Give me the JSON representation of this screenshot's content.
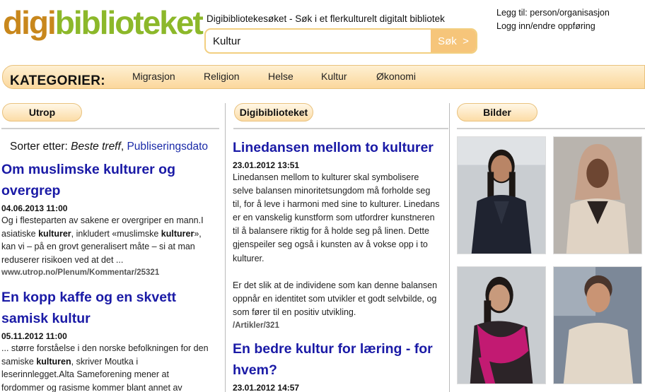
{
  "header": {
    "logo_part1": "digi",
    "logo_part2": "biblioteket",
    "tagline": "Digibibliotekesøket - Søk i et flerkulturelt digitalt bibliotek",
    "search": {
      "value": "Kultur",
      "button_label": "Søk",
      "button_arrow": ">"
    },
    "links": [
      "Legg til: person/organisasjon",
      "Logg inn/endre oppføring"
    ]
  },
  "categories": {
    "title": "KATEGORIER:",
    "items": [
      "Migrasjon",
      "Religion",
      "Helse",
      "Kultur",
      "Økonomi"
    ]
  },
  "columns": {
    "left": {
      "header": "Utrop",
      "sort_label": "Sorter etter:",
      "sort_best": "Beste treff",
      "sort_pub": "Publiseringsdato",
      "articles": [
        {
          "title_line1": "Om muslimske kulturer og",
          "title_line2": "overgrep",
          "date": "04.06.2013 11:00",
          "lines": [
            [
              "Og i flesteparten av sakene er overgriper en mann.I"
            ],
            [
              "asiatiske ",
              "kulturer",
              ", inkludert «muslimske ",
              "kulturer",
              "»,"
            ],
            [
              "kan vi – på en grovt generalisert måte – si at man"
            ],
            [
              "reduserer risikoen ved at det ..."
            ]
          ],
          "url": "www.utrop.no/Plenum/Kommentar/25321"
        },
        {
          "title_line1": "En kopp kaffe og en skvett",
          "title_line2": "samisk kultur",
          "date": "05.11.2012 11:00",
          "lines": [
            [
              "... større forståelse i den norske befolkningen for den"
            ],
            [
              "samiske ",
              "kulturen",
              ", skriver Moutka i"
            ],
            [
              "leserinnlegget.Alta Sameforening mener at"
            ],
            [
              "fordommer og rasisme kommer blant annet av"
            ]
          ]
        }
      ]
    },
    "middle": {
      "header": "Digibiblioteket",
      "articles": [
        {
          "title": "Linedansen mellom to kulturer",
          "date": "23.01.2012 13:51",
          "lines": [
            "Linedansen mellom to kulturer skal symbolisere",
            "selve balansen minoritetsungdom må forholde seg",
            "til, for å leve i harmoni med sine to kulturer. Linedans",
            "er en vanskelig kunstform som utfordrer kunstneren",
            "til å balansere riktig for å holde seg på linen. Dette",
            "gjenspeiler seg også i kunsten av å vokse opp i to",
            "kulturer.",
            "",
            "Er det slik at de individene som kan denne balansen",
            "oppnår en identitet som utvikler et godt selvbilde, og",
            "som fører til en positiv utvikling."
          ],
          "url": "/Artikler/321"
        },
        {
          "title_line1": "En bedre kultur for læring - for",
          "title_line2": "hvem?",
          "date": "23.01.2012 14:57"
        }
      ]
    },
    "right": {
      "header": "Bilder"
    }
  },
  "colors": {
    "link": "#1a1aa6",
    "accent": "#f6c57a",
    "logo_orange": "#c8871c",
    "logo_green": "#8cb82a"
  }
}
